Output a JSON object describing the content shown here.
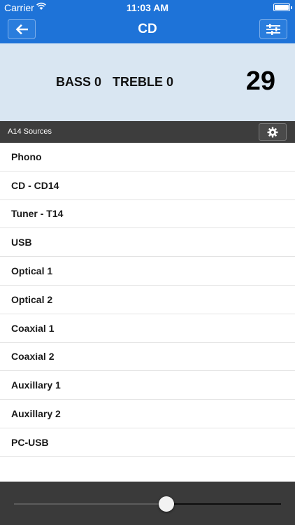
{
  "status_bar": {
    "carrier": "Carrier",
    "time": "11:03 AM",
    "wifi_icon": "wifi-icon",
    "battery_icon": "battery-icon"
  },
  "nav": {
    "title": "CD",
    "back_icon": "arrow-left-icon",
    "settings_icon": "equalizer-icon"
  },
  "audio": {
    "bass": "BASS 0",
    "treble": "TREBLE 0",
    "volume": "29"
  },
  "sources_header": {
    "label": "A14 Sources",
    "gear_icon": "gear-icon"
  },
  "sources": [
    "Phono",
    "CD - CD14",
    "Tuner - T14",
    "USB",
    "Optical 1",
    "Optical 2",
    "Coaxial 1",
    "Coaxial 2",
    "Auxillary 1",
    "Auxillary 2",
    "PC-USB"
  ],
  "volume_slider": {
    "value_fraction": 0.57
  },
  "colors": {
    "accent": "#1e73d8",
    "panel": "#d9e6f2",
    "dark_bar": "#3d3d3d"
  }
}
